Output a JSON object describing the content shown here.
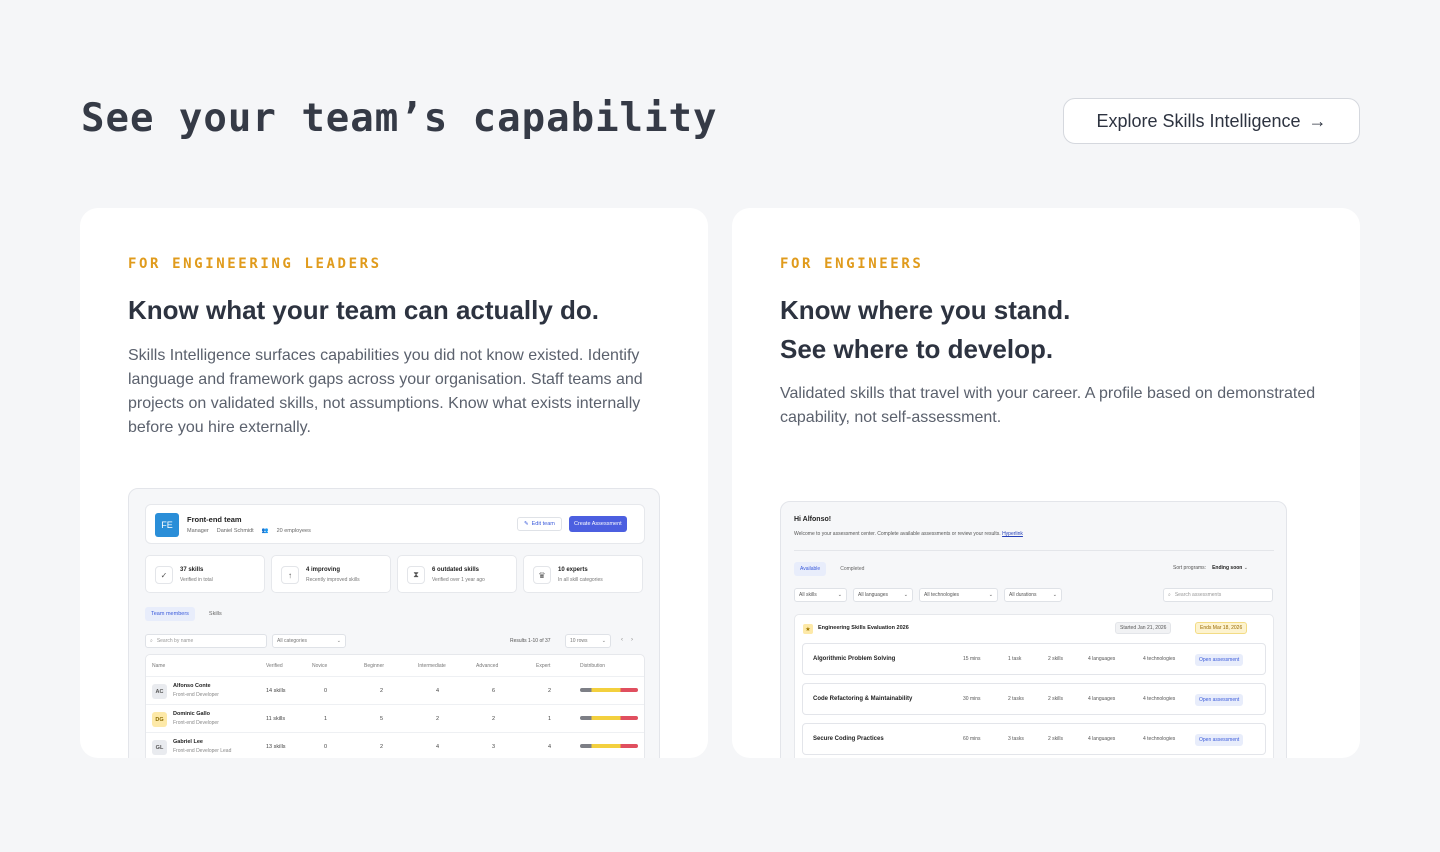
{
  "header": {
    "title": "See your team’s capability",
    "cta_label": "Explore Skills Intelligence",
    "cta_arrow": "→"
  },
  "leaders_card": {
    "eyebrow": "FOR ENGINEERING LEADERS",
    "heading": "Know what your team can actually do.",
    "body": "Skills Intelligence surfaces capabilities you did not know existed. Identify language and framework gaps across your organisation. Staff teams and projects on validated skills, not assumptions. Know what exists internally before you hire externally.",
    "screenshot": {
      "team_initials": "FE",
      "team_name": "Front-end team",
      "manager_label": "Manager",
      "manager_name": "Daniel Schmidt",
      "employees": "20 employees",
      "edit_button": "Edit team",
      "create_button": "Create Assessment",
      "stats": [
        {
          "title": "37 skills",
          "sub": "Verified in total",
          "icon": "check-circle-icon"
        },
        {
          "title": "4 improving",
          "sub": "Recently improved skills",
          "icon": "arrow-up-icon"
        },
        {
          "title": "6 outdated skills",
          "sub": "Verified over 1 year ago",
          "icon": "hourglass-icon"
        },
        {
          "title": "10 experts",
          "sub": "In all skill categories",
          "icon": "crown-icon"
        }
      ],
      "tabs": [
        "Team members",
        "Skills"
      ],
      "search_placeholder": "Search by name",
      "category_select": "All categories",
      "results": "Results 1-10 of 37",
      "rows_select": "10 rows",
      "columns": [
        "Name",
        "Verified",
        "Novice",
        "Beginner",
        "Intermediate",
        "Advanced",
        "Expert",
        "Distribution"
      ],
      "rows": [
        {
          "initials": "AC",
          "name": "Alfonso Conte",
          "role": "Front-end Developer",
          "verified": "14 skills",
          "novice": "0",
          "beginner": "2",
          "intermediate": "4",
          "advanced": "6",
          "expert": "2"
        },
        {
          "initials": "DG",
          "name": "Dominic Gallo",
          "role": "Front-end Developer",
          "verified": "11 skills",
          "novice": "1",
          "beginner": "5",
          "intermediate": "2",
          "advanced": "2",
          "expert": "1"
        },
        {
          "initials": "GL",
          "name": "Gabriel Lee",
          "role": "Front-end Developer Lead",
          "verified": "13 skills",
          "novice": "0",
          "beginner": "2",
          "intermediate": "4",
          "advanced": "3",
          "expert": "4"
        }
      ]
    }
  },
  "engineers_card": {
    "eyebrow": "FOR ENGINEERS",
    "heading_line1": "Know where you stand.",
    "heading_line2": "See where to develop.",
    "body": "Validated skills that travel with your career. A profile based on demonstrated capability, not self-assessment.",
    "screenshot": {
      "greeting": "Hi Alfonso!",
      "welcome": "Welcome to your assessment center. Complete available assessments or review your results.",
      "hyperlink": "Hyperlink",
      "tabs": [
        "Available",
        "Completed"
      ],
      "sort_label": "Sort programs:",
      "sort_value": "Ending soon",
      "filters": [
        "All skills",
        "All languages",
        "All technologies",
        "All durations"
      ],
      "search_placeholder": "Search assessments",
      "program": "Engineering Skills Evaluation 2026",
      "started": "Started Jan 21, 2026",
      "ends": "Ends Mar 18, 2026",
      "assessments": [
        {
          "name": "Algorithmic Problem Solving",
          "time": "15 mins",
          "tasks": "1 task",
          "skills": "2 skills",
          "languages": "4 languages",
          "technologies": "4 technologies",
          "action": "Open assessment"
        },
        {
          "name": "Code Refactoring & Maintainability",
          "time": "30 mins",
          "tasks": "2 tasks",
          "skills": "2 skills",
          "languages": "4 languages",
          "technologies": "4 technologies",
          "action": "Open assessment"
        },
        {
          "name": "Secure Coding Practices",
          "time": "60 mins",
          "tasks": "3 tasks",
          "skills": "2 skills",
          "languages": "4 languages",
          "technologies": "4 technologies",
          "action": "Open assessment"
        }
      ]
    }
  },
  "colors": {
    "accent_eyebrow": "#e09b1c",
    "primary_button": "#4c5fe0",
    "team_badge": "#2a8ed8"
  }
}
